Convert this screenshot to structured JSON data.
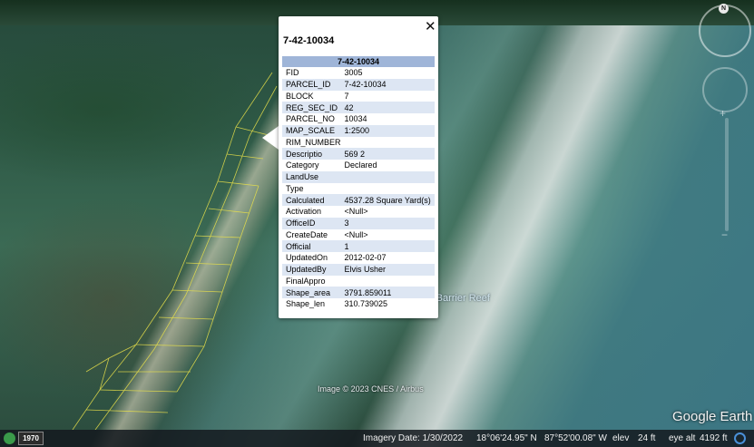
{
  "popup": {
    "title": "7-42-10034",
    "table_header": "7-42-10034",
    "close_label": "✕",
    "rows": [
      {
        "key": "FID",
        "value": "3005"
      },
      {
        "key": "PARCEL_ID",
        "value": "7-42-10034"
      },
      {
        "key": "BLOCK",
        "value": "7"
      },
      {
        "key": "REG_SEC_ID",
        "value": "42"
      },
      {
        "key": "PARCEL_NO",
        "value": "10034"
      },
      {
        "key": "MAP_SCALE",
        "value": "1:2500"
      },
      {
        "key": "RIM_NUMBER",
        "value": ""
      },
      {
        "key": "Descriptio",
        "value": "569 2"
      },
      {
        "key": "Category",
        "value": "Declared"
      },
      {
        "key": "LandUse",
        "value": ""
      },
      {
        "key": "Type",
        "value": ""
      },
      {
        "key": "Calculated",
        "value": "4537.28 Square Yard(s)"
      },
      {
        "key": "Activation",
        "value": "<Null>"
      },
      {
        "key": "OfficeID",
        "value": "3"
      },
      {
        "key": "CreateDate",
        "value": "<Null>"
      },
      {
        "key": "Official",
        "value": "1"
      },
      {
        "key": "UpdatedOn",
        "value": "2012-02-07"
      },
      {
        "key": "UpdatedBy",
        "value": "Elvis Usher"
      },
      {
        "key": "FinalAppro",
        "value": ""
      },
      {
        "key": "Shape_area",
        "value": "3791.859011"
      },
      {
        "key": "Shape_len",
        "value": "310.739025"
      }
    ]
  },
  "map": {
    "reef_label": "elize Barrier Reef",
    "copyright": "Image © 2023 CNES / Airbus",
    "logo": "Google Earth",
    "north_label": "N"
  },
  "statusbar": {
    "year": "1970",
    "imagery_date": "Imagery Date: 1/30/2022",
    "lat": "18°06'24.95\" N",
    "lon": "87°52'00.08\" W",
    "elev_label": "elev",
    "elev_value": "24 ft",
    "eye_label": "eye alt",
    "eye_value": "4192 ft"
  },
  "colors": {
    "header_bg": "#9fb5d8",
    "alt_row_bg": "#dde6f3",
    "parcel_line": "#e8e04a"
  }
}
